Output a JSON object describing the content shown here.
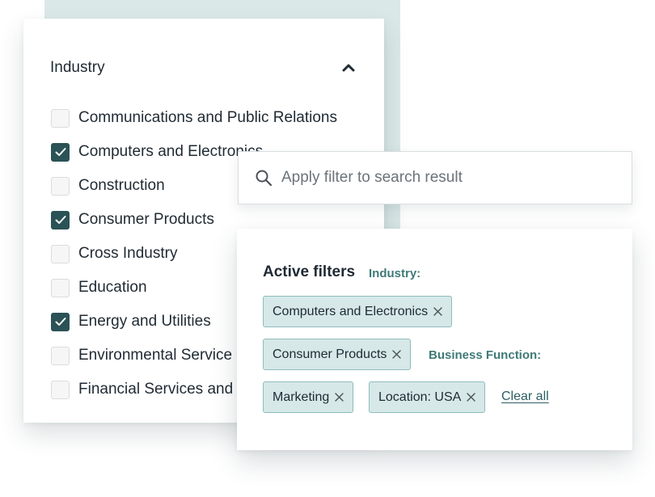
{
  "industry_filter": {
    "title": "Industry",
    "expanded": true,
    "options": [
      {
        "label": "Communications and Public Relations",
        "checked": false
      },
      {
        "label": "Computers and Electronics",
        "checked": true
      },
      {
        "label": "Construction",
        "checked": false
      },
      {
        "label": "Consumer Products",
        "checked": true
      },
      {
        "label": "Cross Industry",
        "checked": false
      },
      {
        "label": "Education",
        "checked": false
      },
      {
        "label": "Energy and Utilities",
        "checked": true
      },
      {
        "label": "Environmental Service",
        "checked": false
      },
      {
        "label": "Financial Services and",
        "checked": false
      }
    ]
  },
  "search": {
    "placeholder": "Apply filter to search result",
    "value": ""
  },
  "active_filters": {
    "title": "Active filters",
    "industry_label": "Industry:",
    "business_function_label": "Business Function:",
    "chips": [
      "Computers and Electronics",
      "Consumer Products",
      "Marketing",
      "Location: USA"
    ],
    "clear_all": "Clear all"
  },
  "icons": {
    "collapse": "chevron-up-icon",
    "search": "search-icon",
    "remove": "close-icon",
    "check": "check-icon"
  },
  "colors": {
    "accent": "#2b5256",
    "chip_background": "#d6e8e8",
    "chip_border": "#8fbcbc",
    "label_teal": "#3f7a78",
    "backdrop": "#dbe8e8"
  }
}
